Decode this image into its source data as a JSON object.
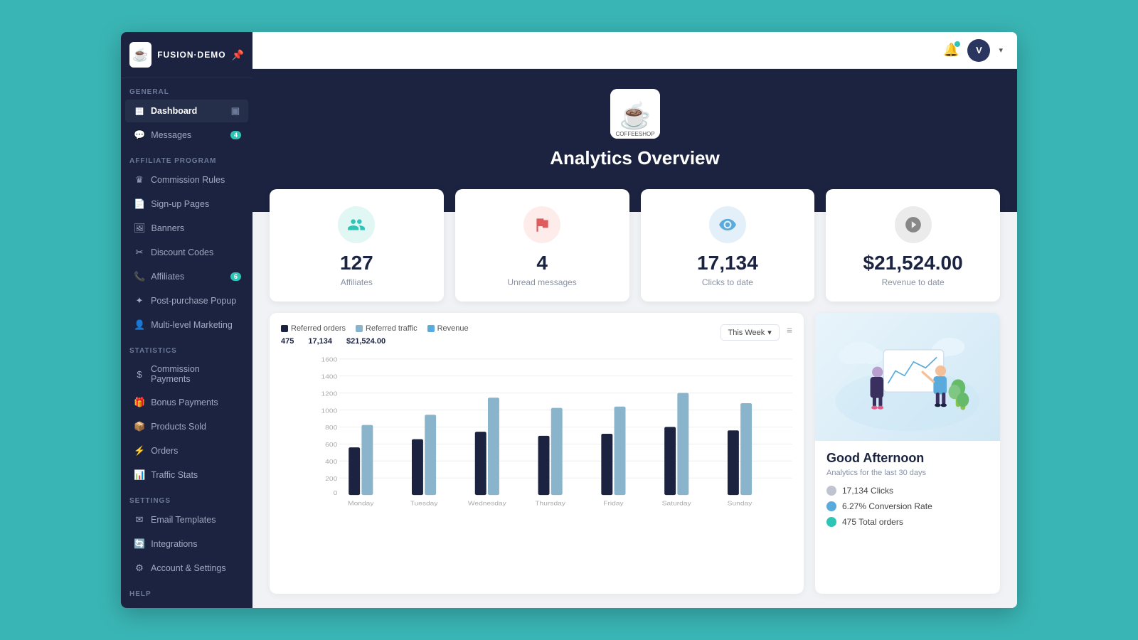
{
  "app": {
    "name": "FUSION·DEMO",
    "logo_emoji": "☕"
  },
  "topbar": {
    "avatar_initial": "V",
    "bell_label": "Notifications"
  },
  "sidebar": {
    "sections": [
      {
        "label": "General",
        "items": [
          {
            "id": "dashboard",
            "label": "Dashboard",
            "icon": "▦",
            "active": true,
            "badge": ""
          },
          {
            "id": "messages",
            "label": "Messages",
            "icon": "💬",
            "active": false,
            "badge": "4"
          }
        ]
      },
      {
        "label": "Affiliate program",
        "items": [
          {
            "id": "commission-rules",
            "label": "Commission Rules",
            "icon": "♛",
            "active": false,
            "badge": ""
          },
          {
            "id": "sign-up-pages",
            "label": "Sign-up Pages",
            "icon": "📄",
            "active": false,
            "badge": ""
          },
          {
            "id": "banners",
            "label": "Banners",
            "icon": "🖼",
            "active": false,
            "badge": ""
          },
          {
            "id": "discount-codes",
            "label": "Discount Codes",
            "icon": "✂",
            "active": false,
            "badge": ""
          },
          {
            "id": "affiliates",
            "label": "Affiliates",
            "icon": "📞",
            "active": false,
            "badge": "6",
            "arrow": "▾"
          },
          {
            "id": "post-purchase",
            "label": "Post-purchase Popup",
            "icon": "✦",
            "active": false,
            "badge": ""
          },
          {
            "id": "mlm",
            "label": "Multi-level Marketing",
            "icon": "👤",
            "active": false,
            "badge": ""
          }
        ]
      },
      {
        "label": "Statistics",
        "items": [
          {
            "id": "commission-payments",
            "label": "Commission Payments",
            "icon": "$",
            "active": false,
            "badge": ""
          },
          {
            "id": "bonus-payments",
            "label": "Bonus Payments",
            "icon": "🎁",
            "active": false,
            "badge": ""
          },
          {
            "id": "products-sold",
            "label": "Products Sold",
            "icon": "📦",
            "active": false,
            "badge": ""
          },
          {
            "id": "orders",
            "label": "Orders",
            "icon": "⚡",
            "active": false,
            "badge": ""
          },
          {
            "id": "traffic-stats",
            "label": "Traffic Stats",
            "icon": "📊",
            "active": false,
            "badge": ""
          }
        ]
      },
      {
        "label": "Settings",
        "items": [
          {
            "id": "email-templates",
            "label": "Email Templates",
            "icon": "✉",
            "active": false,
            "badge": ""
          },
          {
            "id": "integrations",
            "label": "Integrations",
            "icon": "🔄",
            "active": false,
            "badge": ""
          },
          {
            "id": "account-settings",
            "label": "Account & Settings",
            "icon": "⚙",
            "active": false,
            "badge": ""
          }
        ]
      },
      {
        "label": "Help",
        "items": []
      }
    ]
  },
  "hero": {
    "title": "Analytics Overview",
    "logo_emoji": "☕"
  },
  "stats_cards": [
    {
      "id": "affiliates",
      "value": "127",
      "label": "Affiliates",
      "icon": "👥",
      "icon_class": "stat-icon-green"
    },
    {
      "id": "unread-messages",
      "value": "4",
      "label": "Unread messages",
      "icon": "🚩",
      "icon_class": "stat-icon-red"
    },
    {
      "id": "clicks",
      "value": "17,134",
      "label": "Clicks to date",
      "icon": "👁",
      "icon_class": "stat-icon-blue"
    },
    {
      "id": "revenue",
      "value": "$21,524.00",
      "label": "Revenue to date",
      "icon": "🏛",
      "icon_class": "stat-icon-gray"
    }
  ],
  "chart": {
    "legend": [
      {
        "id": "referred-orders",
        "label": "Referred orders",
        "color_class": "legend-dark"
      },
      {
        "id": "referred-traffic",
        "label": "Referred traffic",
        "color_class": "legend-light"
      },
      {
        "id": "revenue",
        "label": "Revenue",
        "color_class": "legend-blue"
      }
    ],
    "stats": [
      {
        "label": "Referred orders",
        "value": "475"
      },
      {
        "label": "Referred traffic",
        "value": "17,134"
      },
      {
        "label": "Revenue",
        "value": "$21,524.00"
      }
    ],
    "filter_label": "This Week",
    "menu_icon": "≡",
    "y_labels": [
      "1600",
      "1400",
      "1200",
      "1000",
      "800",
      "600",
      "400",
      "200",
      "0"
    ],
    "x_labels": [
      "Monday",
      "Tuesday",
      "Wednesday",
      "Thursday",
      "Friday",
      "Saturday",
      "Sunday"
    ],
    "bars": [
      {
        "day": "Monday",
        "dark": 30,
        "light": 52
      },
      {
        "day": "Tuesday",
        "dark": 40,
        "light": 63
      },
      {
        "day": "Wednesday",
        "dark": 46,
        "light": 78
      },
      {
        "day": "Thursday",
        "dark": 36,
        "light": 70
      },
      {
        "day": "Friday",
        "dark": 44,
        "light": 72
      },
      {
        "day": "Saturday",
        "dark": 55,
        "light": 82
      },
      {
        "day": "Sunday",
        "dark": 48,
        "light": 68
      }
    ]
  },
  "right_panel": {
    "greeting": "Good Afternoon",
    "subtitle": "Analytics for the last 30 days",
    "analytics": [
      {
        "id": "clicks",
        "label": "17,134 Clicks",
        "dot_class": "dot-gray"
      },
      {
        "id": "conversion",
        "label": "6.27% Conversion Rate",
        "dot_class": "dot-blue"
      },
      {
        "id": "orders",
        "label": "475 Total orders",
        "dot_class": "dot-green"
      }
    ]
  }
}
